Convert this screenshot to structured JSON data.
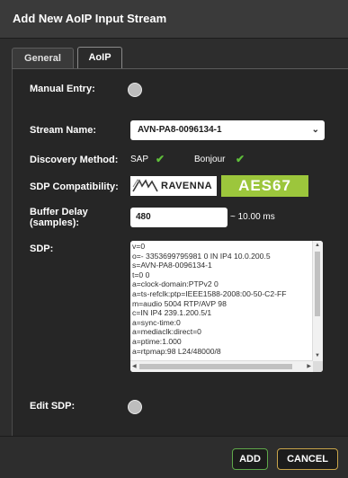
{
  "dialog": {
    "title": "Add New AoIP Input Stream"
  },
  "tabs": [
    {
      "label": "General",
      "active": false
    },
    {
      "label": "AoIP",
      "active": true
    }
  ],
  "form": {
    "manual_entry_label": "Manual Entry:",
    "stream_name_label": "Stream Name:",
    "stream_name_value": "AVN-PA8-0096134-1",
    "discovery_label": "Discovery Method:",
    "discovery_sap": "SAP",
    "discovery_bonjour": "Bonjour",
    "sdp_compat_label": "SDP Compatibility:",
    "ravenna_text": "RAVENNA",
    "aes67_text": "AES67",
    "buffer_label_1": "Buffer Delay",
    "buffer_label_2": "(samples):",
    "buffer_value": "480",
    "buffer_approx": "~ 10.00 ms",
    "sdp_label": "SDP:",
    "sdp_lines": [
      "v=0",
      "o=- 3353699795981 0 IN IP4 10.0.200.5",
      "s=AVN-PA8-0096134-1",
      "t=0 0",
      "a=clock-domain:PTPv2 0",
      "a=ts-refclk:ptp=IEEE1588-2008:00-50-C2-FF",
      "m=audio 5004 RTP/AVP 98",
      "c=IN IP4 239.1.200.5/1",
      "a=sync-time:0",
      "a=mediaclk:direct=0",
      "a=ptime:1.000",
      "a=rtpmap:98 L24/48000/8"
    ],
    "edit_sdp_label": "Edit SDP:"
  },
  "buttons": {
    "add": "ADD",
    "cancel": "CANCEL"
  },
  "colors": {
    "accent_green": "#9cc63c",
    "check_green": "#5fbf3a",
    "add_border": "#5fa84a",
    "cancel_border": "#c9a54a"
  },
  "icons": {
    "check": "checkmark-icon",
    "chevron": "chevron-down-icon"
  }
}
